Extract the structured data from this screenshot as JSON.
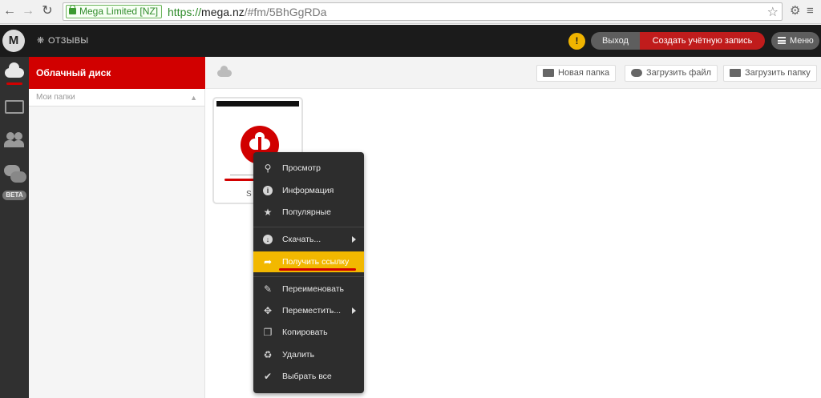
{
  "browser": {
    "ev_badge": "Mega Limited [NZ]",
    "url_scheme": "https://",
    "url_host": "mega.nz",
    "url_path": "/#fm/5BhGgRDa"
  },
  "header": {
    "feedback_label": "ОТЗЫВЫ",
    "logout_label": "Выход",
    "register_label": "Создать учётную запись",
    "menu_label": "Меню",
    "logo_letter": "M"
  },
  "rail": {
    "beta_label": "BETA"
  },
  "tree": {
    "title": "Облачный диск",
    "subheader": "Мои папки"
  },
  "toolbar": {
    "new_folder": "Новая папка",
    "upload_file": "Загрузить файл",
    "upload_folder": "Загрузить папку"
  },
  "file": {
    "name_fragment": "S"
  },
  "context_menu": {
    "items": [
      {
        "label": "Просмотр",
        "icon": "magnifier-icon"
      },
      {
        "label": "Информация",
        "icon": "info-icon"
      },
      {
        "label": "Популярные",
        "icon": "star-icon"
      },
      {
        "label": "Скачать...",
        "icon": "download-icon"
      },
      {
        "label": "Получить ссылку",
        "icon": "share-arrow-icon"
      },
      {
        "label": "Переименовать",
        "icon": "pencil-icon"
      },
      {
        "label": "Переместить...",
        "icon": "move-icon"
      },
      {
        "label": "Копировать",
        "icon": "copy-icon"
      },
      {
        "label": "Удалить",
        "icon": "recycle-icon"
      },
      {
        "label": "Выбрать все",
        "icon": "checkmark-icon"
      }
    ]
  },
  "colors": {
    "brand_red": "#d10000",
    "highlight": "#f2b800",
    "menu_bg": "#2d2d2d"
  }
}
